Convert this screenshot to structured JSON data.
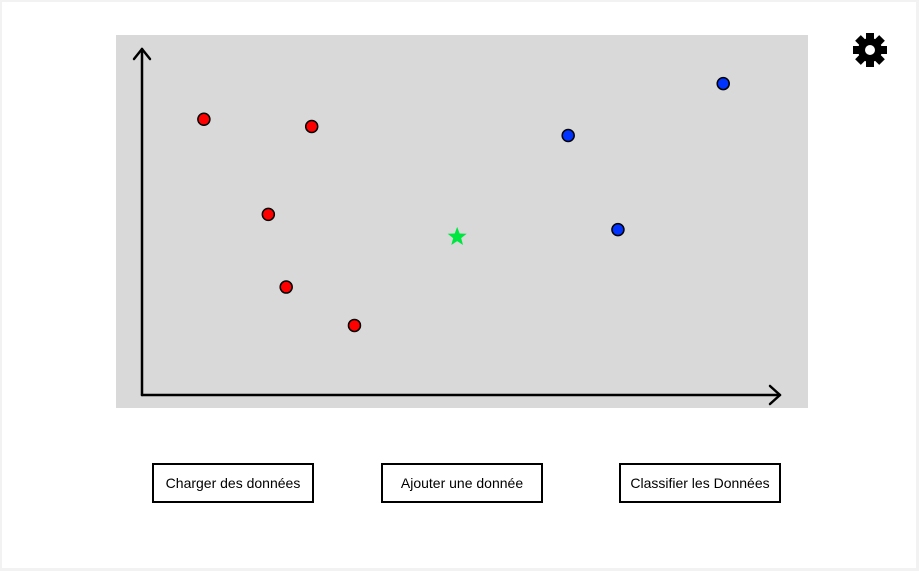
{
  "buttons": {
    "load_label": "Charger des données",
    "add_label": "Ajouter une donnée",
    "classify_label": "Classifier les Données"
  },
  "icons": {
    "settings": "gear-icon"
  },
  "colors": {
    "plot_background": "#d9d9d9",
    "class_a": "#ff0000",
    "class_b": "#0033ff",
    "new_point": "#00e640"
  },
  "chart_data": {
    "type": "scatter",
    "title": "",
    "xlabel": "",
    "ylabel": "",
    "grid": false,
    "xlim": [
      0,
      100
    ],
    "ylim": [
      0,
      100
    ],
    "series": [
      {
        "color": "#ff0000",
        "marker": "circle",
        "points": [
          {
            "x": 9.7,
            "y": 79.7
          },
          {
            "x": 26.6,
            "y": 77.6
          },
          {
            "x": 19.8,
            "y": 52.2
          },
          {
            "x": 22.6,
            "y": 31.2
          },
          {
            "x": 33.3,
            "y": 20.1
          }
        ]
      },
      {
        "color": "#0033ff",
        "marker": "circle",
        "points": [
          {
            "x": 66.8,
            "y": 75.0
          },
          {
            "x": 91.1,
            "y": 90.0
          },
          {
            "x": 74.6,
            "y": 47.8
          }
        ]
      },
      {
        "color": "#00e640",
        "marker": "star",
        "points": [
          {
            "x": 49.4,
            "y": 45.7
          }
        ]
      }
    ]
  }
}
